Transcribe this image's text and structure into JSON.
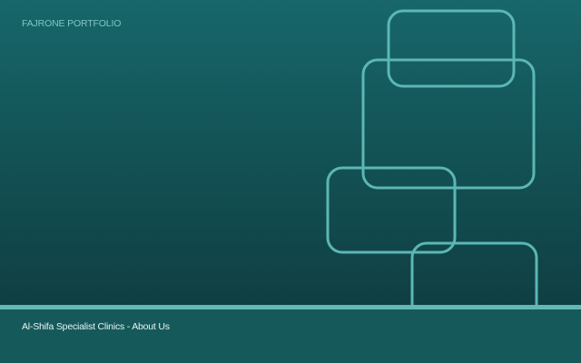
{
  "header": {
    "brand": "FAJRONE PORTFOLIO"
  },
  "footer": {
    "caption": "Al-Shifa Specialist Clinics - About Us"
  },
  "colors": {
    "gradient_top": "#17676b",
    "gradient_bottom": "#0f3f43",
    "outline_shapes": "#5bb7b4",
    "divider": "#62b8b6",
    "footer_bg": "#16595b",
    "brand_text": "#7fc6c3",
    "footer_text": "#e8f4f4"
  }
}
